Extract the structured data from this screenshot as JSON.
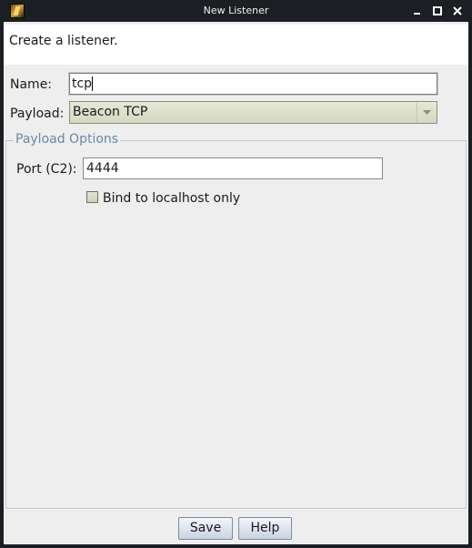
{
  "window": {
    "title": "New Listener"
  },
  "header": {
    "description": "Create a listener."
  },
  "form": {
    "name_label": "Name:",
    "name_value": "tcp",
    "payload_label": "Payload:",
    "payload_value": "Beacon TCP"
  },
  "payload_options": {
    "title": "Payload Options",
    "port_label": "Port (C2):",
    "port_value": "4444",
    "bind_label": "Bind to localhost only",
    "bind_checked": false
  },
  "buttons": {
    "save": "Save",
    "help": "Help"
  },
  "icons": {
    "app": "app-icon",
    "minimize": "minimize-icon",
    "maximize": "maximize-icon",
    "close": "close-icon",
    "dropdown": "chevron-down-icon"
  },
  "colors": {
    "titlebar": "#1b1e22",
    "group_title": "#6b87a8",
    "panel_bg": "#eeeeee"
  }
}
